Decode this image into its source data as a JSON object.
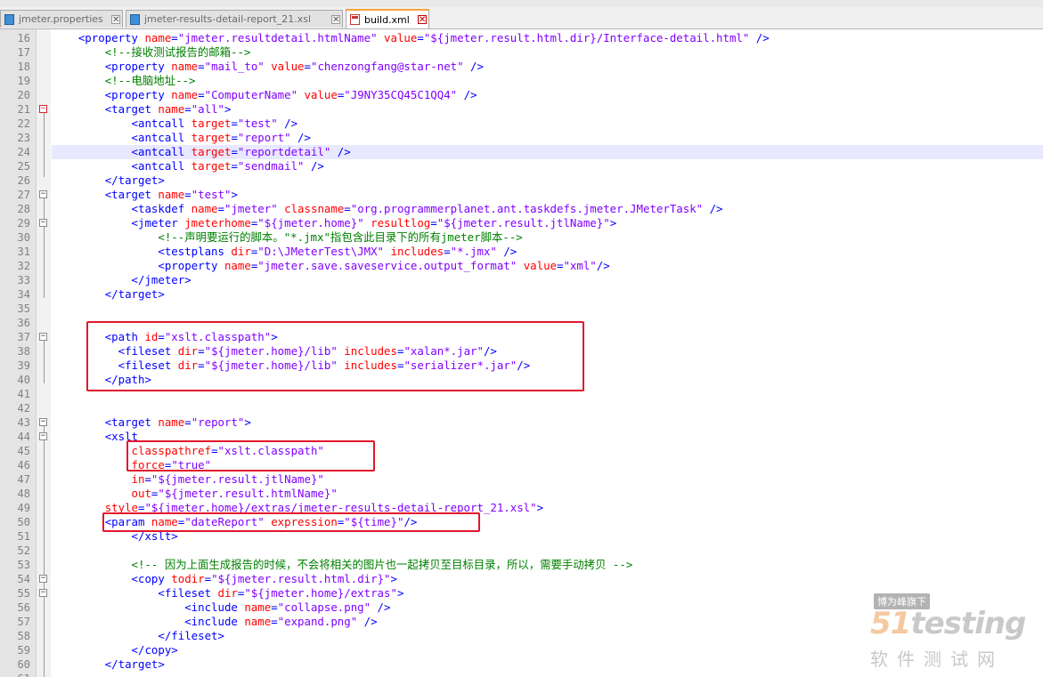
{
  "tabs": [
    {
      "label": "jmeter.properties",
      "icon": "file-icon",
      "active": false
    },
    {
      "label": "jmeter-results-detail-report_21.xsl",
      "icon": "file-icon",
      "active": false
    },
    {
      "label": "build.xml",
      "icon": "file-modified-icon",
      "active": true
    }
  ],
  "watermark": {
    "badge": "博为峰旗下",
    "logo": "51testing",
    "sub": "软件测试网"
  },
  "colors": {
    "tag": "#0000ff",
    "attr": "#ff0000",
    "value": "#8000ff",
    "comment": "#008000",
    "annotation_box": "#e2162b",
    "current_line": "#e8e8ff"
  },
  "lines": [
    {
      "n": "16",
      "fold": "none",
      "segs": [
        [
          "p",
          "    "
        ],
        [
          "t",
          "<property "
        ],
        [
          "a",
          "name"
        ],
        [
          "t",
          "="
        ],
        [
          "v",
          "\"jmeter.resultdetail.htmlName\""
        ],
        [
          "t",
          " "
        ],
        [
          "a",
          "value"
        ],
        [
          "t",
          "="
        ],
        [
          "v",
          "\"${jmeter.result.html.dir}/Interface-detail.html\""
        ],
        [
          "t",
          " />"
        ]
      ]
    },
    {
      "n": "17",
      "fold": "none",
      "segs": [
        [
          "p",
          "        "
        ],
        [
          "c",
          "<!--接收测试报告的邮箱-->"
        ]
      ]
    },
    {
      "n": "18",
      "fold": "none",
      "segs": [
        [
          "p",
          "        "
        ],
        [
          "t",
          "<property "
        ],
        [
          "a",
          "name"
        ],
        [
          "t",
          "="
        ],
        [
          "v",
          "\"mail_to\""
        ],
        [
          "t",
          " "
        ],
        [
          "a",
          "value"
        ],
        [
          "t",
          "="
        ],
        [
          "v",
          "\"chenzongfang@star-net\""
        ],
        [
          "t",
          " />"
        ]
      ]
    },
    {
      "n": "19",
      "fold": "none",
      "segs": [
        [
          "p",
          "        "
        ],
        [
          "c",
          "<!--电脑地址-->"
        ]
      ]
    },
    {
      "n": "20",
      "fold": "none",
      "segs": [
        [
          "p",
          "        "
        ],
        [
          "t",
          "<property "
        ],
        [
          "a",
          "name"
        ],
        [
          "t",
          "="
        ],
        [
          "v",
          "\"ComputerName\""
        ],
        [
          "t",
          " "
        ],
        [
          "a",
          "value"
        ],
        [
          "t",
          "="
        ],
        [
          "v",
          "\"J9NY35CQ45C1QQ4\""
        ],
        [
          "t",
          " />"
        ]
      ]
    },
    {
      "n": "21",
      "fold": "minus-red",
      "segs": [
        [
          "p",
          "        "
        ],
        [
          "t",
          "<target "
        ],
        [
          "a",
          "name"
        ],
        [
          "t",
          "="
        ],
        [
          "v",
          "\"all\""
        ],
        [
          "t",
          ">"
        ]
      ]
    },
    {
      "n": "22",
      "fold": "none",
      "segs": [
        [
          "p",
          "            "
        ],
        [
          "t",
          "<antcall "
        ],
        [
          "a",
          "target"
        ],
        [
          "t",
          "="
        ],
        [
          "v",
          "\"test\""
        ],
        [
          "t",
          " />"
        ]
      ]
    },
    {
      "n": "23",
      "fold": "none",
      "segs": [
        [
          "p",
          "            "
        ],
        [
          "t",
          "<antcall "
        ],
        [
          "a",
          "target"
        ],
        [
          "t",
          "="
        ],
        [
          "v",
          "\"report\""
        ],
        [
          "t",
          " />"
        ]
      ]
    },
    {
      "n": "24",
      "fold": "none",
      "hl": true,
      "segs": [
        [
          "p",
          "            "
        ],
        [
          "t",
          "<antcall "
        ],
        [
          "a",
          "target"
        ],
        [
          "t",
          "="
        ],
        [
          "v",
          "\"reportdetail\""
        ],
        [
          "t",
          " />"
        ]
      ]
    },
    {
      "n": "25",
      "fold": "none",
      "segs": [
        [
          "p",
          "            "
        ],
        [
          "t",
          "<antcall "
        ],
        [
          "a",
          "target"
        ],
        [
          "t",
          "="
        ],
        [
          "v",
          "\"sendmail\""
        ],
        [
          "t",
          " />"
        ]
      ]
    },
    {
      "n": "26",
      "fold": "end",
      "segs": [
        [
          "p",
          "        "
        ],
        [
          "t",
          "</target>"
        ]
      ]
    },
    {
      "n": "27",
      "fold": "minus",
      "segs": [
        [
          "p",
          "        "
        ],
        [
          "t",
          "<target "
        ],
        [
          "a",
          "name"
        ],
        [
          "t",
          "="
        ],
        [
          "v",
          "\"test\""
        ],
        [
          "t",
          ">"
        ]
      ]
    },
    {
      "n": "28",
      "fold": "none",
      "segs": [
        [
          "p",
          "            "
        ],
        [
          "t",
          "<taskdef "
        ],
        [
          "a",
          "name"
        ],
        [
          "t",
          "="
        ],
        [
          "v",
          "\"jmeter\""
        ],
        [
          "t",
          " "
        ],
        [
          "a",
          "classname"
        ],
        [
          "t",
          "="
        ],
        [
          "v",
          "\"org.programmerplanet.ant.taskdefs.jmeter.JMeterTask\""
        ],
        [
          "t",
          " />"
        ]
      ]
    },
    {
      "n": "29",
      "fold": "minus",
      "segs": [
        [
          "p",
          "            "
        ],
        [
          "t",
          "<jmeter "
        ],
        [
          "a",
          "jmeterhome"
        ],
        [
          "t",
          "="
        ],
        [
          "v",
          "\"${jmeter.home}\""
        ],
        [
          "t",
          " "
        ],
        [
          "a",
          "resultlog"
        ],
        [
          "t",
          "="
        ],
        [
          "v",
          "\"${jmeter.result.jtlName}\""
        ],
        [
          "t",
          ">"
        ]
      ]
    },
    {
      "n": "30",
      "fold": "none",
      "segs": [
        [
          "p",
          "                "
        ],
        [
          "c",
          "<!--声明要运行的脚本。\"*.jmx\"指包含此目录下的所有jmeter脚本-->"
        ]
      ]
    },
    {
      "n": "31",
      "fold": "none",
      "segs": [
        [
          "p",
          "                "
        ],
        [
          "t",
          "<testplans "
        ],
        [
          "a",
          "dir"
        ],
        [
          "t",
          "="
        ],
        [
          "v",
          "\"D:\\JMeterTest\\JMX\""
        ],
        [
          "t",
          " "
        ],
        [
          "a",
          "includes"
        ],
        [
          "t",
          "="
        ],
        [
          "v",
          "\"*.jmx\""
        ],
        [
          "t",
          " />"
        ]
      ]
    },
    {
      "n": "32",
      "fold": "none",
      "segs": [
        [
          "p",
          "                "
        ],
        [
          "t",
          "<property "
        ],
        [
          "a",
          "name"
        ],
        [
          "t",
          "="
        ],
        [
          "v",
          "\"jmeter.save.saveservice.output_format\""
        ],
        [
          "t",
          " "
        ],
        [
          "a",
          "value"
        ],
        [
          "t",
          "="
        ],
        [
          "v",
          "\"xml\""
        ],
        [
          "t",
          "/>"
        ]
      ]
    },
    {
      "n": "33",
      "fold": "end",
      "segs": [
        [
          "p",
          "            "
        ],
        [
          "t",
          "</jmeter>"
        ]
      ]
    },
    {
      "n": "34",
      "fold": "end",
      "segs": [
        [
          "p",
          "        "
        ],
        [
          "t",
          "</target>"
        ]
      ]
    },
    {
      "n": "35",
      "fold": "none",
      "segs": []
    },
    {
      "n": "36",
      "fold": "none",
      "segs": []
    },
    {
      "n": "37",
      "fold": "minus",
      "segs": [
        [
          "p",
          "        "
        ],
        [
          "t",
          "<path "
        ],
        [
          "a",
          "id"
        ],
        [
          "t",
          "="
        ],
        [
          "v",
          "\"xslt.classpath\""
        ],
        [
          "t",
          ">"
        ]
      ]
    },
    {
      "n": "38",
      "fold": "none",
      "segs": [
        [
          "p",
          "          "
        ],
        [
          "t",
          "<fileset "
        ],
        [
          "a",
          "dir"
        ],
        [
          "t",
          "="
        ],
        [
          "v",
          "\"${jmeter.home}/lib\""
        ],
        [
          "t",
          " "
        ],
        [
          "a",
          "includes"
        ],
        [
          "t",
          "="
        ],
        [
          "v",
          "\"xalan*.jar\""
        ],
        [
          "t",
          "/>"
        ]
      ]
    },
    {
      "n": "39",
      "fold": "none",
      "segs": [
        [
          "p",
          "          "
        ],
        [
          "t",
          "<fileset "
        ],
        [
          "a",
          "dir"
        ],
        [
          "t",
          "="
        ],
        [
          "v",
          "\"${jmeter.home}/lib\""
        ],
        [
          "t",
          " "
        ],
        [
          "a",
          "includes"
        ],
        [
          "t",
          "="
        ],
        [
          "v",
          "\"serializer*.jar\""
        ],
        [
          "t",
          "/>"
        ]
      ]
    },
    {
      "n": "40",
      "fold": "end",
      "segs": [
        [
          "p",
          "        "
        ],
        [
          "t",
          "</path>"
        ]
      ]
    },
    {
      "n": "41",
      "fold": "none",
      "segs": []
    },
    {
      "n": "42",
      "fold": "none",
      "segs": []
    },
    {
      "n": "43",
      "fold": "minus",
      "segs": [
        [
          "p",
          "        "
        ],
        [
          "t",
          "<target "
        ],
        [
          "a",
          "name"
        ],
        [
          "t",
          "="
        ],
        [
          "v",
          "\"report\""
        ],
        [
          "t",
          ">"
        ]
      ]
    },
    {
      "n": "44",
      "fold": "minus",
      "segs": [
        [
          "p",
          "        "
        ],
        [
          "t",
          "<xslt"
        ]
      ]
    },
    {
      "n": "45",
      "fold": "none",
      "segs": [
        [
          "p",
          "            "
        ],
        [
          "a",
          "classpathref"
        ],
        [
          "t",
          "="
        ],
        [
          "v",
          "\"xslt.classpath\""
        ]
      ]
    },
    {
      "n": "46",
      "fold": "none",
      "segs": [
        [
          "p",
          "            "
        ],
        [
          "a",
          "force"
        ],
        [
          "t",
          "="
        ],
        [
          "v",
          "\"true\""
        ]
      ]
    },
    {
      "n": "47",
      "fold": "none",
      "segs": [
        [
          "p",
          "            "
        ],
        [
          "a",
          "in"
        ],
        [
          "t",
          "="
        ],
        [
          "v",
          "\"${jmeter.result.jtlName}\""
        ]
      ]
    },
    {
      "n": "48",
      "fold": "none",
      "segs": [
        [
          "p",
          "            "
        ],
        [
          "a",
          "out"
        ],
        [
          "t",
          "="
        ],
        [
          "v",
          "\"${jmeter.result.htmlName}\""
        ]
      ]
    },
    {
      "n": "49",
      "fold": "none",
      "segs": [
        [
          "p",
          "        "
        ],
        [
          "a",
          "style"
        ],
        [
          "t",
          "="
        ],
        [
          "v",
          "\"${jmeter.home}/extras/jmeter-results-detail-report_21.xsl\""
        ],
        [
          "t",
          ">"
        ]
      ]
    },
    {
      "n": "50",
      "fold": "none",
      "segs": [
        [
          "p",
          "        "
        ],
        [
          "t",
          "<param "
        ],
        [
          "a",
          "name"
        ],
        [
          "t",
          "="
        ],
        [
          "v",
          "\"dateReport\""
        ],
        [
          "t",
          " "
        ],
        [
          "a",
          "expression"
        ],
        [
          "t",
          "="
        ],
        [
          "v",
          "\"${time}\""
        ],
        [
          "t",
          "/>"
        ]
      ]
    },
    {
      "n": "51",
      "fold": "end",
      "segs": [
        [
          "p",
          "            "
        ],
        [
          "t",
          "</xslt>"
        ]
      ]
    },
    {
      "n": "52",
      "fold": "none",
      "segs": []
    },
    {
      "n": "53",
      "fold": "none",
      "segs": [
        [
          "p",
          "            "
        ],
        [
          "c",
          "<!-- 因为上面生成报告的时候，不会将相关的图片也一起拷贝至目标目录，所以，需要手动拷贝 -->"
        ]
      ]
    },
    {
      "n": "54",
      "fold": "minus",
      "segs": [
        [
          "p",
          "            "
        ],
        [
          "t",
          "<copy "
        ],
        [
          "a",
          "todir"
        ],
        [
          "t",
          "="
        ],
        [
          "v",
          "\"${jmeter.result.html.dir}\""
        ],
        [
          "t",
          ">"
        ]
      ]
    },
    {
      "n": "55",
      "fold": "minus",
      "segs": [
        [
          "p",
          "                "
        ],
        [
          "t",
          "<fileset "
        ],
        [
          "a",
          "dir"
        ],
        [
          "t",
          "="
        ],
        [
          "v",
          "\"${jmeter.home}/extras\""
        ],
        [
          "t",
          ">"
        ]
      ]
    },
    {
      "n": "56",
      "fold": "none",
      "segs": [
        [
          "p",
          "                    "
        ],
        [
          "t",
          "<include "
        ],
        [
          "a",
          "name"
        ],
        [
          "t",
          "="
        ],
        [
          "v",
          "\"collapse.png\""
        ],
        [
          "t",
          " />"
        ]
      ]
    },
    {
      "n": "57",
      "fold": "none",
      "segs": [
        [
          "p",
          "                    "
        ],
        [
          "t",
          "<include "
        ],
        [
          "a",
          "name"
        ],
        [
          "t",
          "="
        ],
        [
          "v",
          "\"expand.png\""
        ],
        [
          "t",
          " />"
        ]
      ]
    },
    {
      "n": "58",
      "fold": "end",
      "segs": [
        [
          "p",
          "                "
        ],
        [
          "t",
          "</fileset>"
        ]
      ]
    },
    {
      "n": "59",
      "fold": "end",
      "segs": [
        [
          "p",
          "            "
        ],
        [
          "t",
          "</copy>"
        ]
      ]
    },
    {
      "n": "60",
      "fold": "end",
      "segs": [
        [
          "p",
          "        "
        ],
        [
          "t",
          "</target>"
        ]
      ]
    },
    {
      "n": "61",
      "fold": "none",
      "segs": []
    }
  ]
}
